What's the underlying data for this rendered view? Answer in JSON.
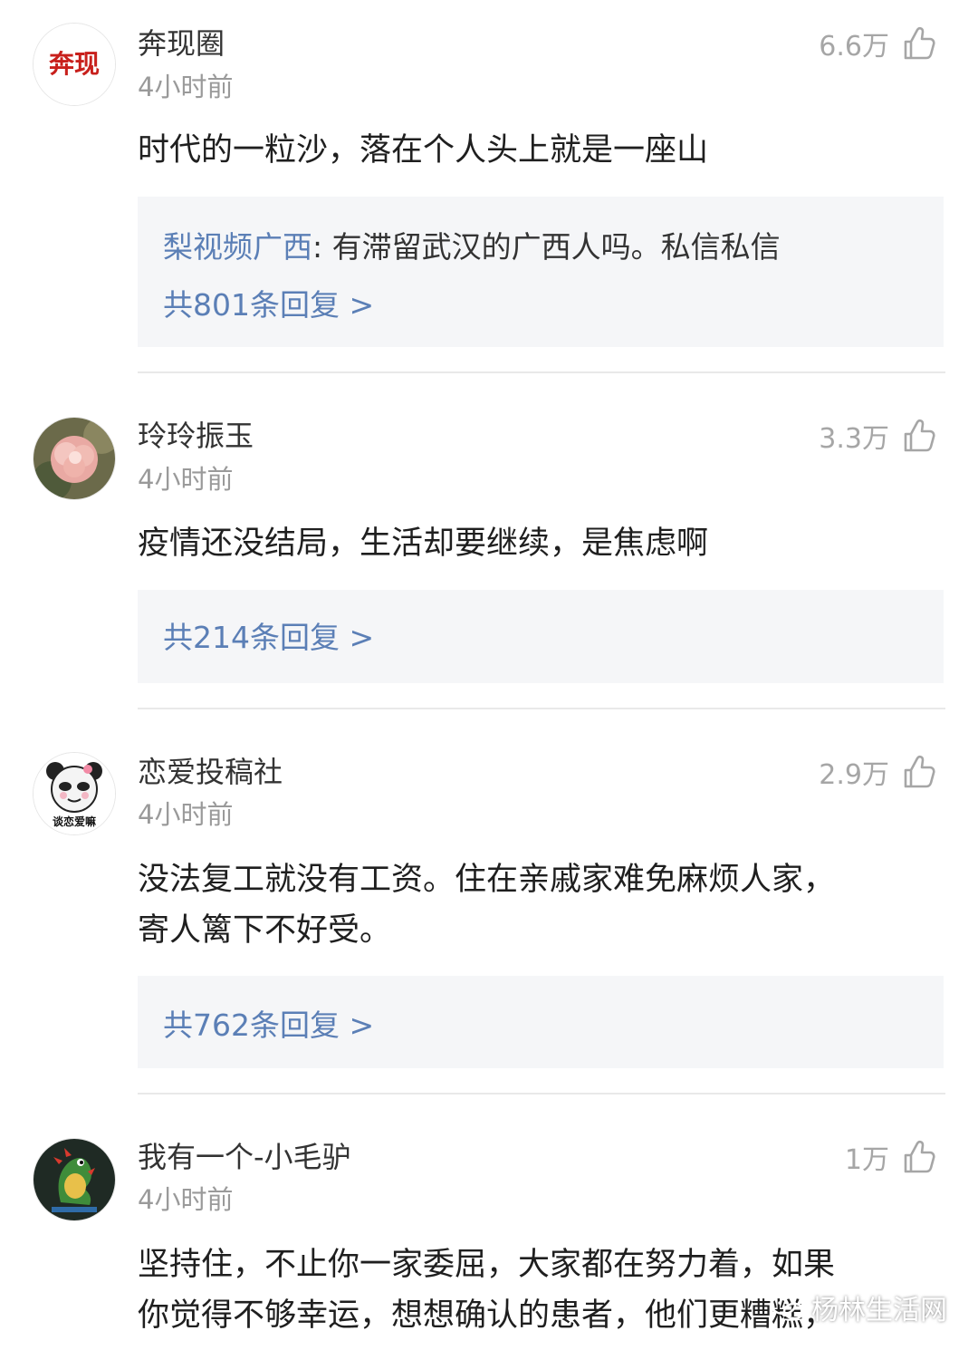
{
  "comments": [
    {
      "avatar_text": "奔现",
      "username": "奔现圈",
      "time": "4小时前",
      "likes": "6.6万",
      "text": "时代的一粒沙，落在个人头上就是一座山",
      "reply_preview": {
        "author": "梨视频广西",
        "separator": ": ",
        "text": "有滞留武汉的广西人吗。私信私信"
      },
      "reply_link": "共801条回复 >"
    },
    {
      "username": "玲玲振玉",
      "time": "4小时前",
      "likes": "3.3万",
      "text": "疫情还没结局，生活却要继续，是焦虑啊",
      "reply_link": "共214条回复 >"
    },
    {
      "avatar_text": "谈恋爱嘛",
      "username": "恋爱投稿社",
      "time": "4小时前",
      "likes": "2.9万",
      "text_lines": [
        "没法复工就没有工资。住在亲戚家难免麻烦人家，",
        "寄人篱下不好受。"
      ],
      "reply_link": "共762条回复 >"
    },
    {
      "username": "我有一个-小毛驴",
      "time": "4小时前",
      "likes": "1万",
      "text_lines": [
        "坚持住，不止你一家委屈，大家都在努力着，如果",
        "你觉得不够幸运，想想确认的患者，他们更糟糕，"
      ]
    }
  ],
  "watermark": {
    "text": "杨林生活网",
    "icon": "wechat-icon"
  },
  "colors": {
    "link": "#5b7fb6",
    "likes": "#a6a6a6",
    "reply_bg": "#f5f6f8",
    "avatar_red": "#c8201c"
  }
}
